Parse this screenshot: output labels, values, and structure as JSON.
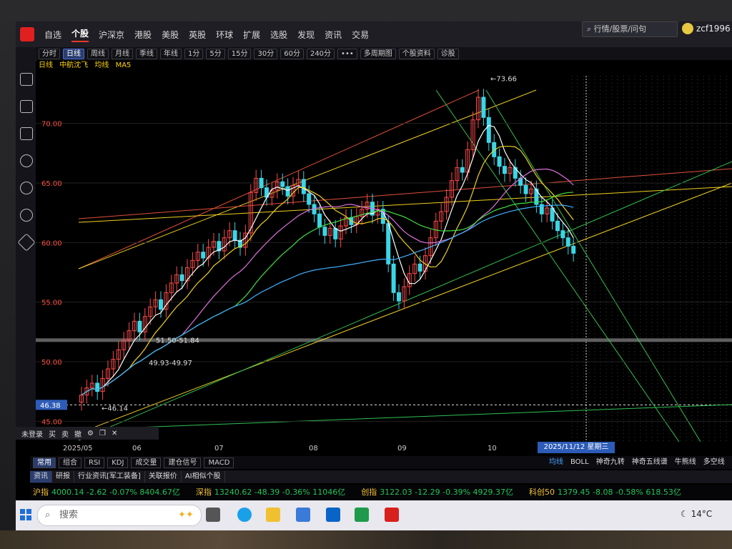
{
  "app": {
    "nav": [
      "自选",
      "个股",
      "沪深京",
      "港股",
      "美股",
      "英股",
      "环球",
      "扩展",
      "选股",
      "发现",
      "资讯",
      "交易"
    ],
    "active_nav": "个股",
    "search_placeholder": "行情/股票/问句",
    "username": "zcf1996"
  },
  "toolbar": {
    "items": [
      "分时",
      "日线",
      "周线",
      "月线",
      "季线",
      "年线",
      "1分",
      "5分",
      "15分",
      "30分",
      "60分",
      "240分",
      "•••",
      "多周期图",
      "个股资料",
      "诊股"
    ],
    "active": "日线"
  },
  "info": {
    "period": "日线",
    "stock": "中航沈飞",
    "indicator1": "均线",
    "indicator2": "MA5"
  },
  "chart_data": {
    "type": "candlestick",
    "y_ticks": [
      "70.00",
      "65.00",
      "60.00",
      "55.00",
      "50.00",
      "45.00"
    ],
    "y_range": [
      44,
      74
    ],
    "x_ticks": [
      "2025/05",
      "06",
      "07",
      "08",
      "09",
      "10"
    ],
    "annotations": {
      "high": "←73.66",
      "low": "←46.14",
      "current_price": "46.38",
      "zone1": "51.50-51.84",
      "zone2": "49.93-49.97"
    },
    "cursor_date": "2025/11/12 星期三",
    "closes": [
      47.2,
      47.8,
      48.2,
      47.5,
      48.6,
      49.4,
      50.2,
      51.0,
      51.8,
      52.6,
      53.4,
      52.5,
      53.8,
      54.6,
      55.2,
      54.4,
      55.8,
      56.6,
      57.3,
      56.8,
      57.9,
      58.5,
      59.2,
      58.7,
      59.6,
      60.1,
      59.3,
      60.4,
      61.0,
      60.2,
      59.6,
      60.8,
      64.2,
      65.4,
      64.6,
      63.8,
      64.4,
      65.1,
      64.7,
      63.9,
      64.8,
      65.3,
      64.1,
      63.2,
      62.4,
      61.3,
      60.6,
      61.2,
      60.3,
      61.4,
      62.1,
      61.5,
      62.2,
      62.8,
      63.4,
      62.3,
      62.8,
      61.6,
      58.2,
      55.8,
      55.1,
      56.3,
      57.4,
      58.2,
      57.6,
      58.9,
      60.4,
      61.8,
      62.6,
      63.8,
      65.2,
      66.3,
      65.9,
      67.8,
      70.3,
      72.2,
      70.5,
      68.4,
      67.2,
      66.4,
      65.8,
      66.3,
      65.4,
      64.8,
      64.1,
      64.5,
      63.2,
      62.4,
      62.9,
      61.8,
      61.0,
      60.4,
      59.7,
      59.1
    ]
  },
  "float_tools": [
    "未登录",
    "买",
    "卖",
    "撤",
    "⚙",
    "❐",
    "✕"
  ],
  "indicator_tabs": {
    "left": [
      "常用",
      "组合"
    ],
    "items": [
      "RSI",
      "KDJ",
      "成交量",
      "建仓信号",
      "MACD"
    ],
    "right": [
      "均线",
      "BOLL",
      "神奇九转",
      "神奇五线谱",
      "牛熊线",
      "多空线"
    ],
    "right_active": "均线"
  },
  "news_tabs": [
    "资讯",
    "研报",
    "行业资讯[军工装备]",
    "关联报价",
    "AI相似个股"
  ],
  "ticker": [
    {
      "name": "沪指",
      "value": "4000.14  -2.62  -0.07%  8404.67亿"
    },
    {
      "name": "深指",
      "value": "13240.62  -48.39  -0.36%  11046亿"
    },
    {
      "name": "创指",
      "value": "3122.03  -12.29  -0.39%  4929.37亿"
    },
    {
      "name": "科创50",
      "value": "1379.45  -8.08  -0.58%  618.53亿"
    }
  ],
  "taskbar": {
    "search_label": "搜索",
    "weather": "14°C"
  }
}
